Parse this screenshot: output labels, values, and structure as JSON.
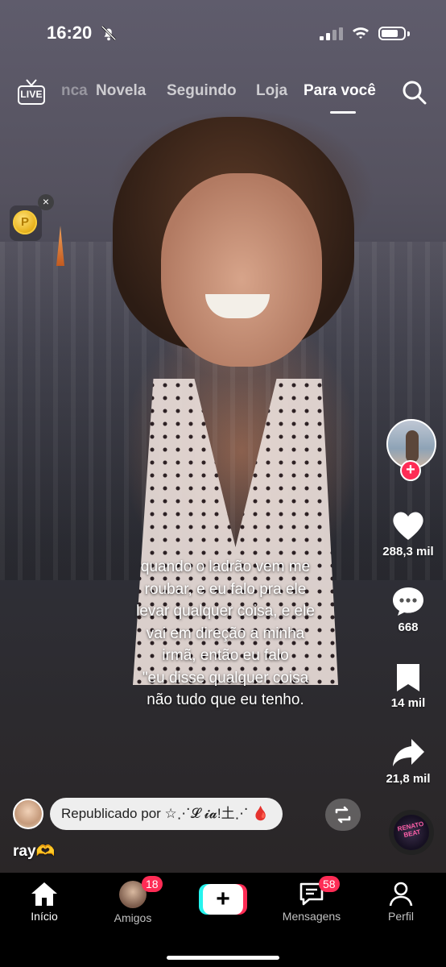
{
  "status_bar": {
    "time": "16:20"
  },
  "top_nav": {
    "live_label": "LIVE",
    "tabs": [
      {
        "label": "nca"
      },
      {
        "label": "Novela"
      },
      {
        "label": "Seguindo"
      },
      {
        "label": "Loja"
      },
      {
        "label": "Para você",
        "active": true
      }
    ]
  },
  "coin_widget": {
    "symbol": "P",
    "close": "×"
  },
  "caption": {
    "lines": [
      "quando o ladrão vem me",
      "roubar, e eu falo pra ele",
      "levar qualquer coisa, e ele",
      "vai em direção a minha",
      "irmã, então eu falo",
      "\"eu disse qualquer coisa",
      "não tudo que eu tenho."
    ]
  },
  "actions": {
    "follow": "+",
    "likes": "288,3 mil",
    "comments": "668",
    "saves": "14 mil",
    "shares": "21,8 mil"
  },
  "repost": {
    "prefix": "Republicado por",
    "name": "☆⋰𝓛 𝓲𝓪!土⋰",
    "emoji": "🩸"
  },
  "music": {
    "label": "RENATO BEAT"
  },
  "author": {
    "username": "ray🫶"
  },
  "bottom_nav": {
    "items": [
      {
        "label": "Início",
        "active": true
      },
      {
        "label": "Amigos",
        "badge": "18"
      },
      {
        "label": "+"
      },
      {
        "label": "Mensagens",
        "badge": "58"
      },
      {
        "label": "Perfil"
      }
    ]
  },
  "colors": {
    "accent": "#fe2c55",
    "cyan": "#25f4ee",
    "bar": "#000000"
  }
}
